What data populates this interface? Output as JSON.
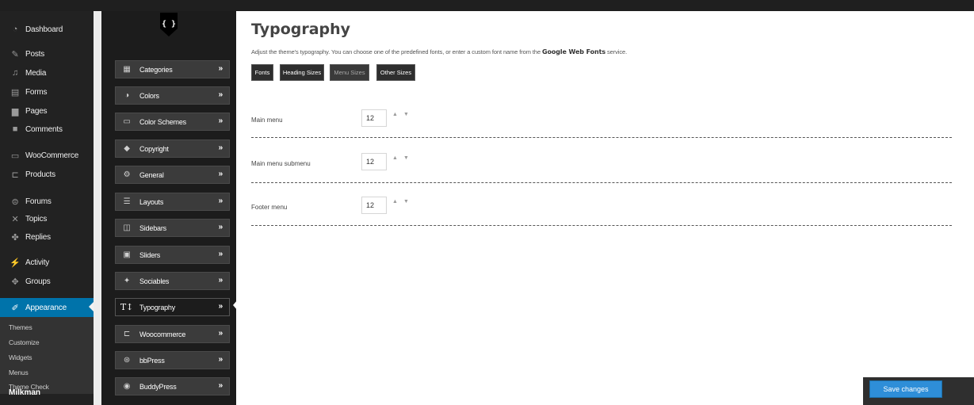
{
  "wp_sidebar": {
    "items": [
      {
        "label": "Dashboard",
        "icon": "dashboard-icon"
      },
      {
        "label": "Posts",
        "icon": "pin-icon"
      },
      {
        "label": "Media",
        "icon": "media-icon"
      },
      {
        "label": "Forms",
        "icon": "forms-icon"
      },
      {
        "label": "Pages",
        "icon": "pages-icon"
      },
      {
        "label": "Comments",
        "icon": "comment-icon"
      },
      {
        "label": "WooCommerce",
        "icon": "woocommerce-icon"
      },
      {
        "label": "Products",
        "icon": "cart-icon"
      },
      {
        "label": "Forums",
        "icon": "forums-icon"
      },
      {
        "label": "Topics",
        "icon": "topics-icon"
      },
      {
        "label": "Replies",
        "icon": "replies-icon"
      },
      {
        "label": "Activity",
        "icon": "activity-icon"
      },
      {
        "label": "Groups",
        "icon": "groups-icon"
      },
      {
        "label": "Appearance",
        "icon": "paintbrush-icon"
      }
    ],
    "submenu": [
      "Themes",
      "Customize",
      "Widgets",
      "Menus",
      "Theme Check"
    ],
    "cut_off_label": "Milkman",
    "active_color": "#0073aa"
  },
  "options_panel": {
    "logo_glyph": "{ }",
    "items": [
      {
        "label": "Categories",
        "icon": "grid-icon"
      },
      {
        "label": "Colors",
        "icon": "contrast-icon"
      },
      {
        "label": "Color Schemes",
        "icon": "monitor-icon"
      },
      {
        "label": "Copyright",
        "icon": "tag-icon"
      },
      {
        "label": "General",
        "icon": "gears-icon"
      },
      {
        "label": "Layouts",
        "icon": "list-icon"
      },
      {
        "label": "Sidebars",
        "icon": "columns-icon"
      },
      {
        "label": "Sliders",
        "icon": "image-icon"
      },
      {
        "label": "Sociables",
        "icon": "twitter-icon"
      },
      {
        "label": "Typography",
        "icon": "typography-icon"
      },
      {
        "label": "Woocommerce",
        "icon": "cart-icon"
      },
      {
        "label": "bbPress",
        "icon": "bbpress-icon"
      },
      {
        "label": "BuddyPress",
        "icon": "buddypress-icon"
      }
    ],
    "arrow": "»",
    "active_index": 9
  },
  "main": {
    "title": "Typography",
    "description": "Adjust the theme's typography. You can choose one of the predefined fonts, or enter a custom font name from the",
    "description_link": "Google Web Fonts",
    "description_end": "service.",
    "tabs": [
      "Fonts",
      "Heading Sizes",
      "Menu Sizes",
      "Other Sizes"
    ],
    "active_tab": "Menu Sizes",
    "fields": [
      {
        "label": "Main menu",
        "value": "12"
      },
      {
        "label": "Main menu submenu",
        "value": "12"
      },
      {
        "label": "Footer menu",
        "value": "12"
      }
    ],
    "spin_up": "▲",
    "spin_down": "▼"
  },
  "save_button": {
    "label": "Save changes",
    "color": "#2e8ed8"
  }
}
